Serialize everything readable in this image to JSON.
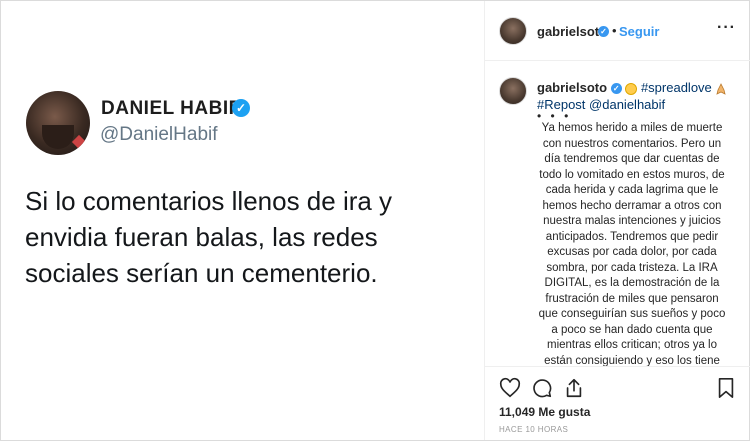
{
  "tweet": {
    "name": "DANIEL HABIF",
    "handle": "@DanielHabif",
    "text": "Si lo comentarios llenos de ira y envidia fueran balas, las redes sociales serían un cementerio."
  },
  "header": {
    "username": "gabrielsoto",
    "separator": "•",
    "follow_label": "Seguir",
    "more_icon": "more-options-icon"
  },
  "caption": {
    "username": "gabrielsoto",
    "hashtag": "#spreadlove",
    "repost_tag": "#Repost",
    "repost_user": "@danielhabif",
    "dots": "• • •",
    "body": "Ya hemos herido a miles de muerte con nuestros comentarios. Pero un día tendremos que dar cuentas de todo lo vomitado en estos muros, de cada herida y cada lagrima que le hemos hecho derramar a otros con nuestra malas intenciones y juicios anticipados. Tendremos que pedir excusas por cada dolor, por cada sombra, por cada tristeza. La IRA DIGITAL, es la demostración de la frustración de miles que pensaron que conseguirían sus sueños y poco a poco se han dado cuenta que mientras ellos critican; otros ya lo están consiguiendo y eso los tiene muy pero muy cabreados. Dios los"
  },
  "actions": {
    "likes": "11,049 Me gusta",
    "timestamp": "HACE 10 HORAS"
  },
  "colors": {
    "link_blue": "#3897f0",
    "twitter_blue": "#1da1f2",
    "handle_gray": "#657786",
    "hashtag_navy": "#003569"
  }
}
